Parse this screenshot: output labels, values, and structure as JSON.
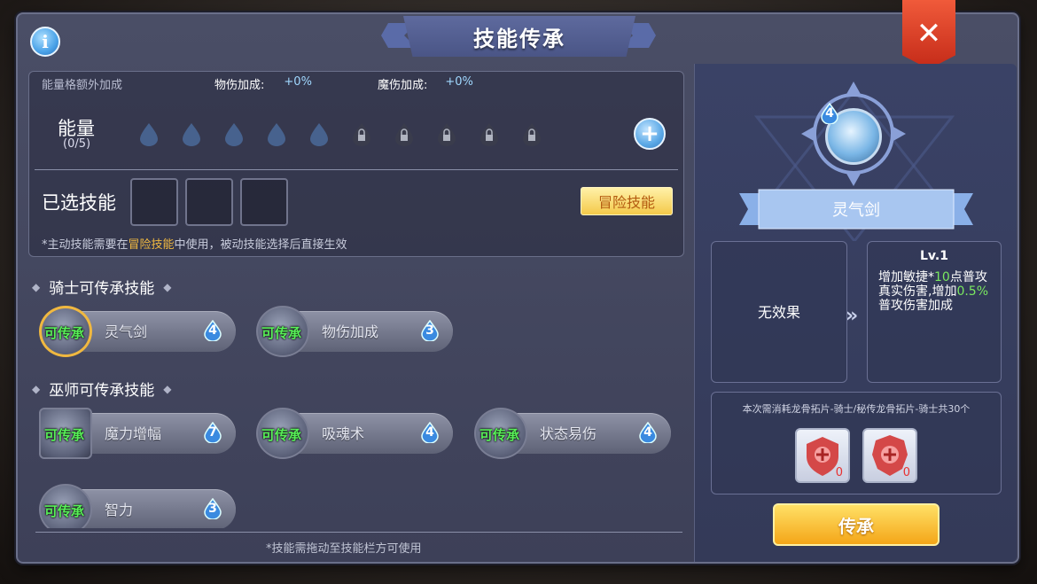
{
  "title": "技能传承",
  "bonus": {
    "label": "能量格额外加成",
    "phys_label": "物伤加成:",
    "phys_value": "+0%",
    "magic_label": "魔伤加成:",
    "magic_value": "+0%"
  },
  "energy": {
    "label": "能量",
    "count": "(0/5)",
    "unlocked_slots": 5,
    "locked_slots": 5
  },
  "selected": {
    "label": "已选技能",
    "slots": 3,
    "adventure_button": "冒险技能",
    "note_prefix": "*主动技能需要在",
    "note_highlight": "冒险技能",
    "note_suffix": "中使用，被动技能选择后直接生效"
  },
  "sections": [
    {
      "title": "骑士可传承技能",
      "skills": [
        {
          "tag": "可传承",
          "name": "灵气剑",
          "cost": "4"
        },
        {
          "tag": "可传承",
          "name": "物伤加成",
          "cost": "3"
        }
      ]
    },
    {
      "title": "巫师可传承技能",
      "skills": [
        {
          "tag": "可传承",
          "name": "魔力增幅",
          "cost": "7"
        },
        {
          "tag": "可传承",
          "name": "吸魂术",
          "cost": "4"
        },
        {
          "tag": "可传承",
          "name": "状态易伤",
          "cost": "4"
        },
        {
          "tag": "可传承",
          "name": "智力",
          "cost": "3"
        }
      ]
    }
  ],
  "bottom_note": "*技能需拖动至技能栏方可使用",
  "detail": {
    "level_badge": "4",
    "skill_name": "灵气剑",
    "current_effect": "无效果",
    "next_level": "Lv.1",
    "effect_1": "增加敏捷*",
    "effect_1_num": "10",
    "effect_2": "点普攻真实伤害,增加",
    "effect_2_num": "0.5%",
    "effect_3": "普攻伤害加成",
    "cost_text": "本次需消耗龙骨拓片-骑士/秘传龙骨拓片-骑士共30个",
    "items": [
      {
        "icon": "dragon-bone-rubbing-icon",
        "qty": "0"
      },
      {
        "icon": "secret-dragon-bone-rubbing-icon",
        "qty": "0"
      }
    ],
    "inherit_button": "传承"
  },
  "colors": {
    "accent_green": "#58f058",
    "accent_gold": "#f0b840",
    "panel": "#4a4e66",
    "button_orange": "#f4a618"
  }
}
